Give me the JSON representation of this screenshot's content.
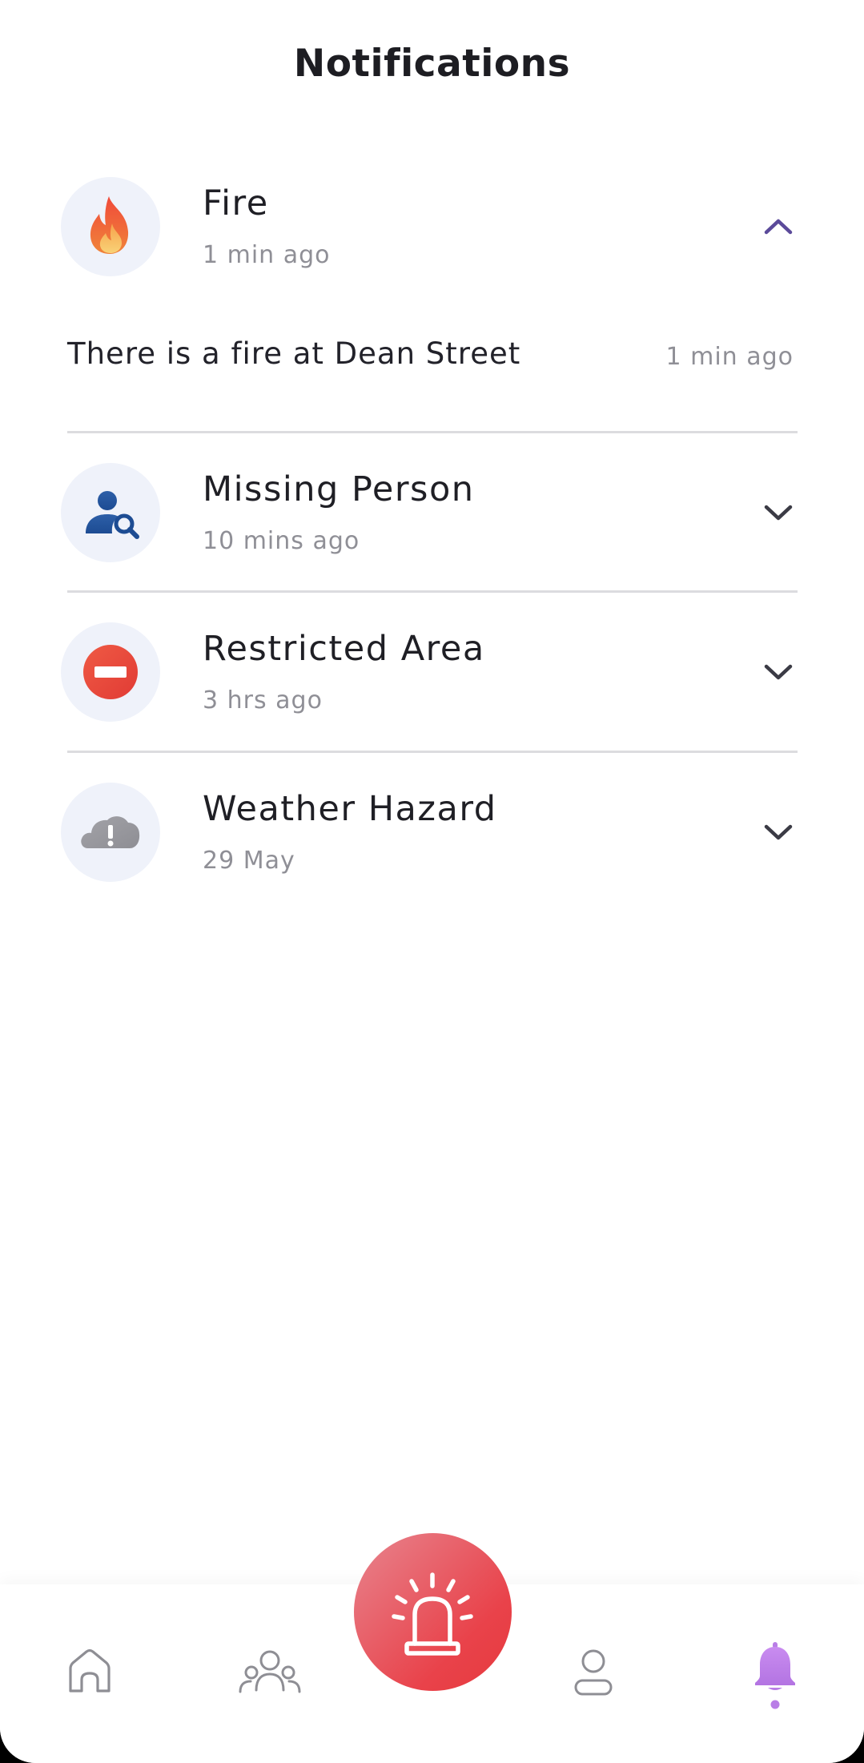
{
  "header": {
    "title": "Notifications"
  },
  "notifications": [
    {
      "title": "Fire",
      "time": "1 min ago",
      "icon": "fire-icon",
      "expanded": true,
      "detail": {
        "text": "There is a fire at Dean Street",
        "time": "1 min ago"
      }
    },
    {
      "title": "Missing Person",
      "time": "10 mins ago",
      "icon": "person-search-icon",
      "expanded": false
    },
    {
      "title": "Restricted Area",
      "time": "3 hrs ago",
      "icon": "no-entry-icon",
      "expanded": false
    },
    {
      "title": "Weather Hazard",
      "time": "29 May",
      "icon": "cloud-warning-icon",
      "expanded": false
    }
  ],
  "bottom_nav": {
    "items": [
      {
        "name": "home",
        "icon": "home-icon",
        "active": false
      },
      {
        "name": "community",
        "icon": "group-icon",
        "active": false
      },
      {
        "name": "alarm",
        "icon": "siren-icon",
        "active": false
      },
      {
        "name": "profile",
        "icon": "person-icon",
        "active": false
      },
      {
        "name": "notifications",
        "icon": "bell-icon",
        "active": true
      }
    ]
  },
  "colors": {
    "accent": "#b97ee6",
    "chevron_active": "#5b4a9a",
    "alarm_start": "#e7848e",
    "alarm_end": "#e63a3e",
    "icon_bg": "#eff2fa"
  }
}
